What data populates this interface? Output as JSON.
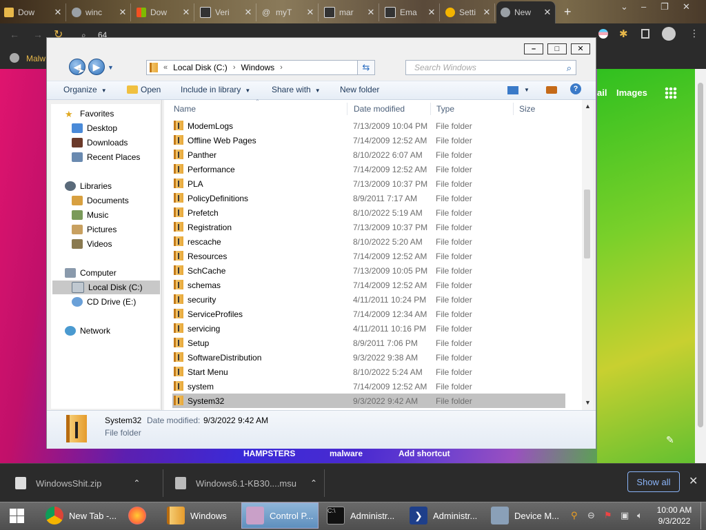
{
  "browser": {
    "tabs": [
      {
        "label": "Dow",
        "color": "#e8b84a"
      },
      {
        "label": "winc",
        "color": "#9aa0a6"
      },
      {
        "label": "Dow",
        "color": "#f25022"
      },
      {
        "label": "Veri",
        "color": "#333333"
      },
      {
        "label": "myT",
        "color": "#aaaaaa"
      },
      {
        "label": "mar",
        "color": "#333333"
      },
      {
        "label": "Ema",
        "color": "#333333"
      },
      {
        "label": "Setti",
        "color": "#f4b400"
      },
      {
        "label": "New",
        "color": "#9aa0a6"
      }
    ],
    "new_tab": "+",
    "address_partial": "64",
    "bookmark": "Malw",
    "page_links": {
      "mail": "ail",
      "images": "Images"
    },
    "shortcuts": [
      "HAMPSTERS",
      "malware",
      "Add shortcut"
    ]
  },
  "explorer": {
    "window_controls": {
      "minimize": "–",
      "maximize": "□",
      "close": "✕"
    },
    "breadcrumb": {
      "prefix": "«",
      "items": [
        "Local Disk (C:)",
        "Windows"
      ]
    },
    "search_placeholder": "Search Windows",
    "commands": {
      "organize": "Organize",
      "open": "Open",
      "include": "Include in library",
      "share": "Share with",
      "new_folder": "New folder"
    },
    "nav": {
      "favorites": "Favorites",
      "desktop": "Desktop",
      "downloads": "Downloads",
      "recent": "Recent Places",
      "libraries": "Libraries",
      "documents": "Documents",
      "music": "Music",
      "pictures": "Pictures",
      "videos": "Videos",
      "computer": "Computer",
      "local_disk": "Local Disk (C:)",
      "cd_drive": "CD Drive (E:)",
      "network": "Network"
    },
    "columns": {
      "name": "Name",
      "date": "Date modified",
      "type": "Type",
      "size": "Size"
    },
    "rows": [
      {
        "name": "ModemLogs",
        "date": "7/13/2009 10:04 PM",
        "type": "File folder"
      },
      {
        "name": "Offline Web Pages",
        "date": "7/14/2009 12:52 AM",
        "type": "File folder"
      },
      {
        "name": "Panther",
        "date": "8/10/2022 6:07 AM",
        "type": "File folder"
      },
      {
        "name": "Performance",
        "date": "7/14/2009 12:52 AM",
        "type": "File folder"
      },
      {
        "name": "PLA",
        "date": "7/13/2009 10:37 PM",
        "type": "File folder"
      },
      {
        "name": "PolicyDefinitions",
        "date": "8/9/2011 7:17 AM",
        "type": "File folder"
      },
      {
        "name": "Prefetch",
        "date": "8/10/2022 5:19 AM",
        "type": "File folder"
      },
      {
        "name": "Registration",
        "date": "7/13/2009 10:37 PM",
        "type": "File folder"
      },
      {
        "name": "rescache",
        "date": "8/10/2022 5:20 AM",
        "type": "File folder"
      },
      {
        "name": "Resources",
        "date": "7/14/2009 12:52 AM",
        "type": "File folder"
      },
      {
        "name": "SchCache",
        "date": "7/13/2009 10:05 PM",
        "type": "File folder"
      },
      {
        "name": "schemas",
        "date": "7/14/2009 12:52 AM",
        "type": "File folder"
      },
      {
        "name": "security",
        "date": "4/11/2011 10:24 PM",
        "type": "File folder"
      },
      {
        "name": "ServiceProfiles",
        "date": "7/14/2009 12:34 AM",
        "type": "File folder"
      },
      {
        "name": "servicing",
        "date": "4/11/2011 10:16 PM",
        "type": "File folder"
      },
      {
        "name": "Setup",
        "date": "8/9/2011 7:06 PM",
        "type": "File folder"
      },
      {
        "name": "SoftwareDistribution",
        "date": "9/3/2022 9:38 AM",
        "type": "File folder"
      },
      {
        "name": "Start Menu",
        "date": "8/10/2022 5:24 AM",
        "type": "File folder"
      },
      {
        "name": "system",
        "date": "7/14/2009 12:52 AM",
        "type": "File folder"
      },
      {
        "name": "System32",
        "date": "9/3/2022 9:42 AM",
        "type": "File folder",
        "selected": true
      }
    ],
    "details": {
      "name": "System32",
      "date_label": "Date modified:",
      "date_value": "9/3/2022 9:42 AM",
      "type": "File folder"
    }
  },
  "downloads": {
    "items": [
      "WindowsShit.zip",
      "Windows6.1-KB30....msu"
    ],
    "show_all": "Show all"
  },
  "taskbar": {
    "items": [
      {
        "label": "New Tab -...",
        "color": "#db4437"
      },
      {
        "label": "",
        "color": "#ff7139"
      },
      {
        "label": "Windows",
        "color": "#e8a93a"
      },
      {
        "label": "Control P...",
        "color": "#c9a0c8"
      },
      {
        "label": "Administr...",
        "color": "#111111"
      },
      {
        "label": "Administr...",
        "color": "#1e3f8a"
      },
      {
        "label": "Device M...",
        "color": "#8aa0b8"
      }
    ],
    "time": "10:00 AM",
    "date": "9/3/2022"
  }
}
